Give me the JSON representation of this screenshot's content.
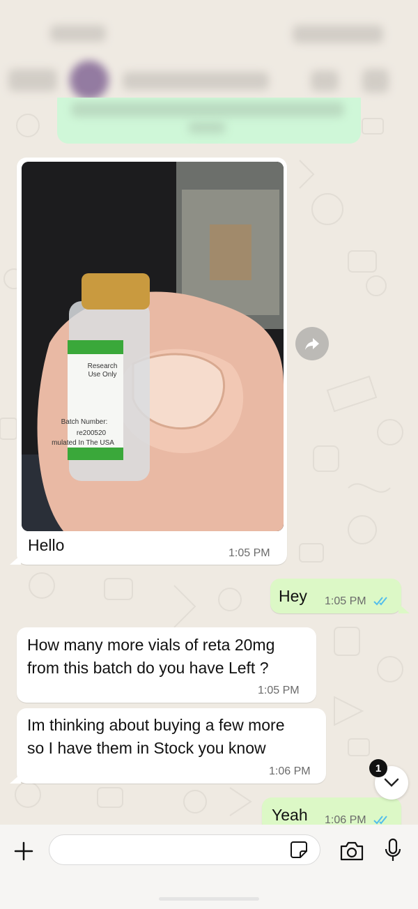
{
  "messages": [
    {
      "id": "m1",
      "dir": "in",
      "text": "Hello",
      "time": "1:05 PM",
      "has_image": true,
      "image_labels": {
        "line1": "Research",
        "line2": "Use Only",
        "line3": "Batch Number:",
        "line4": "re200520",
        "line5": "mulated In The USA"
      }
    },
    {
      "id": "m2",
      "dir": "out",
      "text": "Hey",
      "time": "1:05 PM",
      "status": "read"
    },
    {
      "id": "m3",
      "dir": "in",
      "text": "How many more vials of reta 20mg\nfrom this batch do you have Left ?",
      "time": "1:05 PM"
    },
    {
      "id": "m4",
      "dir": "in",
      "text": "Im thinking about buying a few more\nso I have them in Stock you know",
      "time": "1:06 PM"
    },
    {
      "id": "m5",
      "dir": "out",
      "text": "Yeah",
      "time": "1:06 PM",
      "status": "read"
    }
  ],
  "scroll_badge": "1",
  "colors": {
    "incoming": "#ffffff",
    "outgoing": "#dcf8c6",
    "read_ticks": "#53bdeb",
    "wallpaper": "#efeae2"
  },
  "icons": {
    "add": "plus-icon",
    "sticker": "sticker-icon",
    "camera": "camera-icon",
    "mic": "mic-icon",
    "forward": "forward-icon",
    "scroll": "chevron-down-icon"
  }
}
